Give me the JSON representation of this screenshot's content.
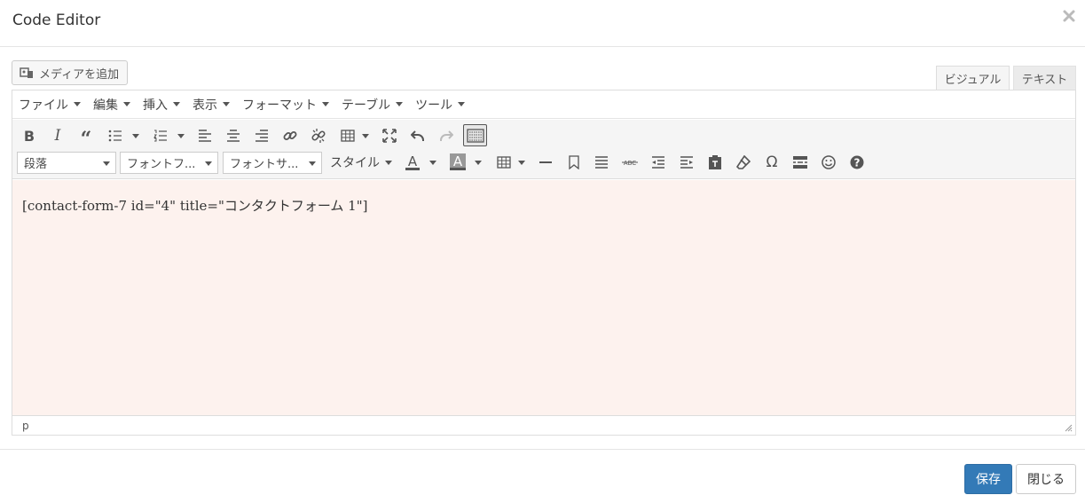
{
  "modal": {
    "title": "Code Editor",
    "close_icon": "close-icon"
  },
  "media_button": {
    "label": "メディアを追加",
    "icon": "media-icon"
  },
  "tabs": [
    {
      "label": "ビジュアル"
    },
    {
      "label": "テキスト"
    }
  ],
  "menubar": [
    {
      "label": "ファイル"
    },
    {
      "label": "編集"
    },
    {
      "label": "挿入"
    },
    {
      "label": "表示"
    },
    {
      "label": "フォーマット"
    },
    {
      "label": "テーブル"
    },
    {
      "label": "ツール"
    }
  ],
  "toolbar_row1": [
    "bold-icon",
    "italic-icon",
    "blockquote-icon",
    "bullet-list-icon",
    "numbered-list-icon",
    "align-left-icon",
    "align-center-icon",
    "align-right-icon",
    "link-icon",
    "unlink-icon",
    "table-icon",
    "fullscreen-icon",
    "undo-icon",
    "redo-icon",
    "toolbar-toggle-icon"
  ],
  "toolbar_row2": {
    "format_select": "段落",
    "font_family_select": "フォントフ...",
    "font_size_select": "フォントサ...",
    "style_menu": "スタイル",
    "icons": [
      "text-color-icon",
      "background-color-icon",
      "table-icon",
      "horizontal-line-icon",
      "bookmark-icon",
      "justify-icon",
      "strikethrough-icon",
      "outdent-icon",
      "indent-icon",
      "paste-text-icon",
      "clear-formatting-icon",
      "special-character-icon",
      "read-more-icon",
      "emoticons-icon",
      "help-icon"
    ]
  },
  "editor": {
    "content": "[contact-form-7 id=\"4\" title=\"コンタクトフォーム 1\"]",
    "path": "p",
    "background_color": "#fdf2ee"
  },
  "footer": {
    "save_label": "保存",
    "close_label": "閉じる",
    "primary_color": "#337ab7"
  }
}
